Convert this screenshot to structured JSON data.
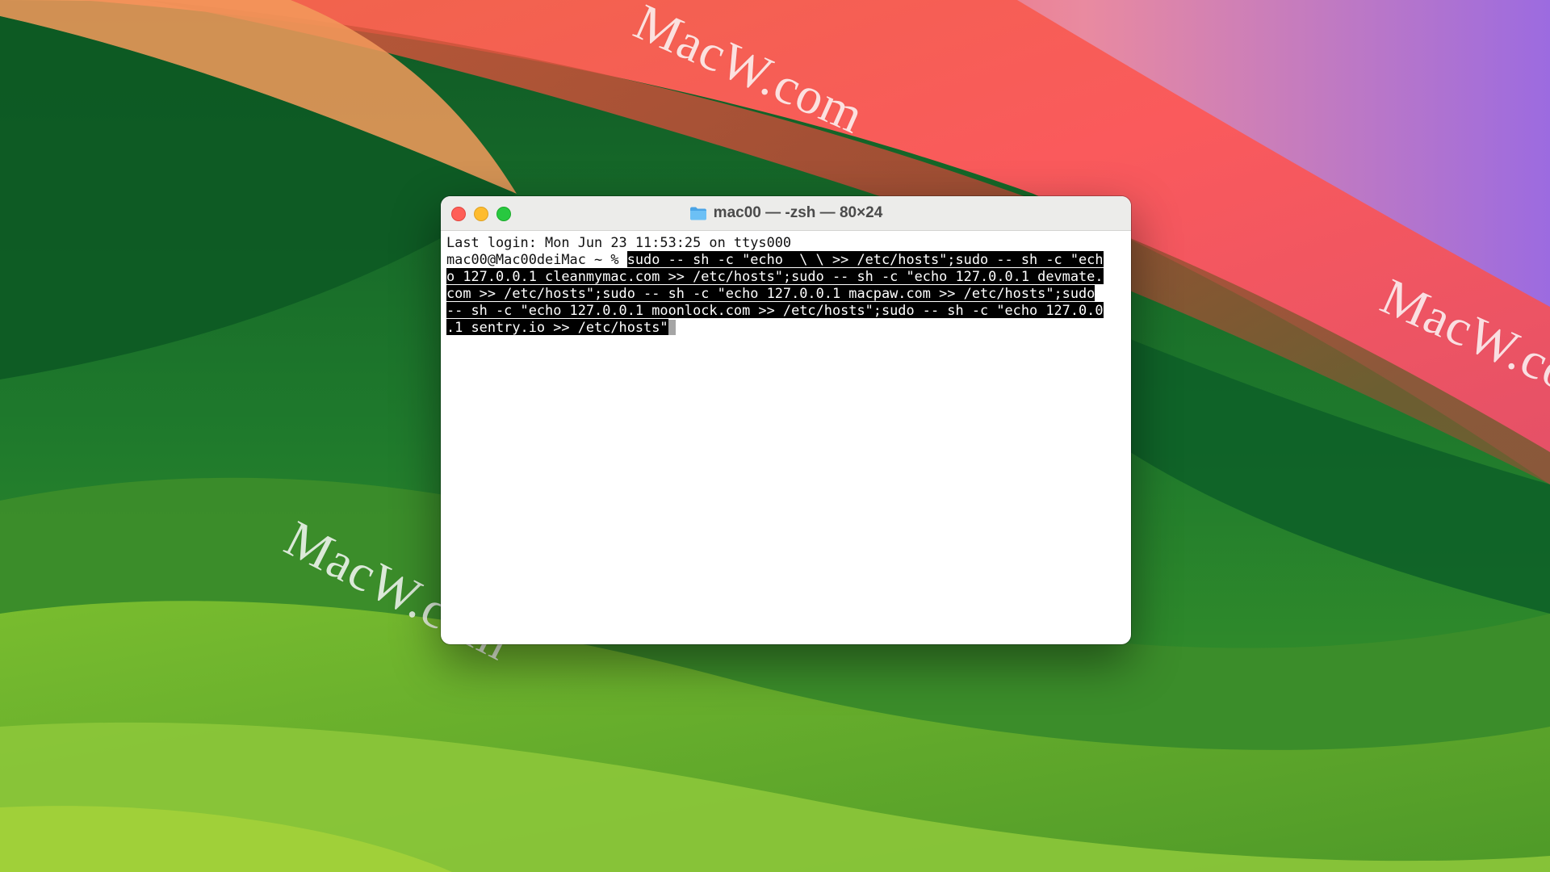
{
  "desktop": {
    "watermarks": [
      "MacW.com",
      "MacW.com",
      "MacW.com"
    ]
  },
  "window": {
    "title": "mac00 — -zsh — 80×24",
    "folder_icon": "folder-icon"
  },
  "terminal": {
    "login_line": "Last login: Mon Jun 23 11:53:25 on ttys000",
    "prompt": "mac00@Mac00deiMac ~ % ",
    "command_lines": [
      "sudo -- sh -c \"echo  \\ \\ >> /etc/hosts\";sudo -- sh -c \"ech",
      "o 127.0.0.1 cleanmymac.com >> /etc/hosts\";sudo -- sh -c \"echo 127.0.0.1 devmate.",
      "com >> /etc/hosts\";sudo -- sh -c \"echo 127.0.0.1 macpaw.com >> /etc/hosts\";sudo",
      "-- sh -c \"echo 127.0.0.1 moonlock.com >> /etc/hosts\";sudo -- sh -c \"echo 127.0.0",
      ".1 sentry.io >> /etc/hosts\""
    ]
  },
  "colors": {
    "close": "#ff5f57",
    "minimize": "#febc2e",
    "zoom": "#28c840",
    "selection": "#000000"
  }
}
